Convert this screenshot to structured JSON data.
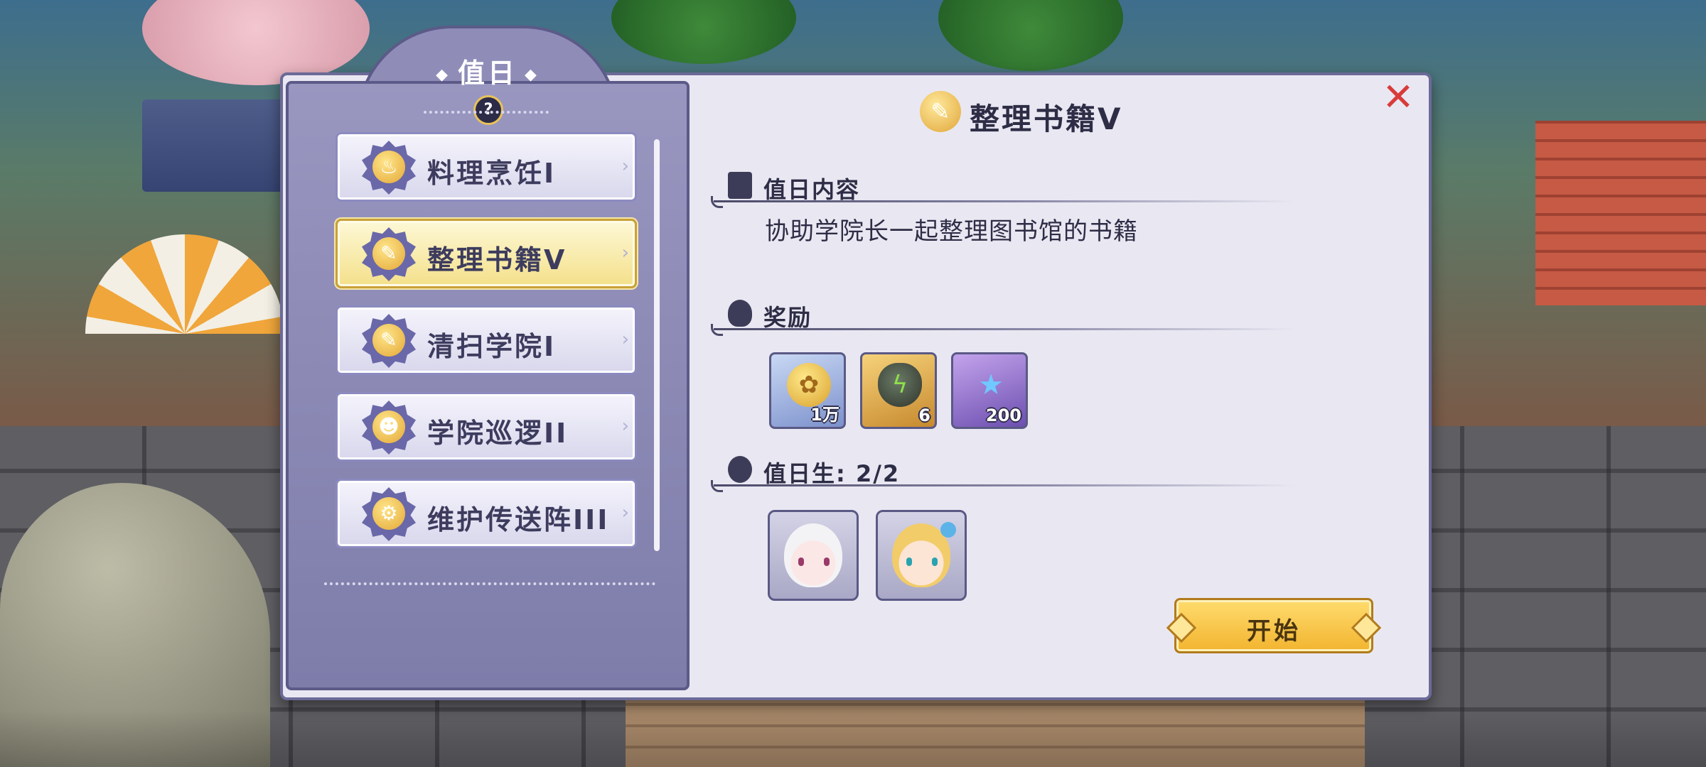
{
  "left_panel": {
    "title": "值日",
    "title_deco_left": "◆",
    "title_deco_right": "◆",
    "help_label": "?",
    "items": [
      {
        "label": "料理烹饪I",
        "icon": "cooking-pot-icon",
        "glyph": "♨",
        "selected": false
      },
      {
        "label": "整理书籍V",
        "icon": "broom-icon",
        "glyph": "✎",
        "selected": true
      },
      {
        "label": "清扫学院I",
        "icon": "broom-icon",
        "glyph": "✎",
        "selected": false
      },
      {
        "label": "学院巡逻II",
        "icon": "group-icon",
        "glyph": "☻",
        "selected": false
      },
      {
        "label": "维护传送阵III",
        "icon": "gear-wrench-icon",
        "glyph": "⚙",
        "selected": false
      }
    ]
  },
  "detail": {
    "title": "整理书籍V",
    "title_icon_glyph": "✎",
    "close_label": "✕",
    "content_heading": "值日内容",
    "content_text": "协助学院长一起整理图书馆的书籍",
    "reward_heading": "奖励",
    "rewards": [
      {
        "icon": "gold-coin-icon",
        "glyph": "✿",
        "qty": "1万",
        "style": "blue"
      },
      {
        "icon": "green-ore-icon",
        "glyph": "ϟ",
        "qty": "6",
        "style": "gold"
      },
      {
        "icon": "exp-star-icon",
        "glyph": "★",
        "qty": "200",
        "style": "purple"
      }
    ],
    "members_heading": "值日生: 2/2",
    "members": [
      {
        "icon": "white-hair-girl-avatar",
        "style": "white"
      },
      {
        "icon": "blonde-girl-avatar",
        "style": "blonde"
      }
    ],
    "start_label": "开始"
  },
  "colors": {
    "frame": "#6b6a98",
    "panel_bg": "#e9e8f2",
    "selected_item": "#f4e08a",
    "start_button": "#f2b42f",
    "close_x": "#d93b3b"
  }
}
